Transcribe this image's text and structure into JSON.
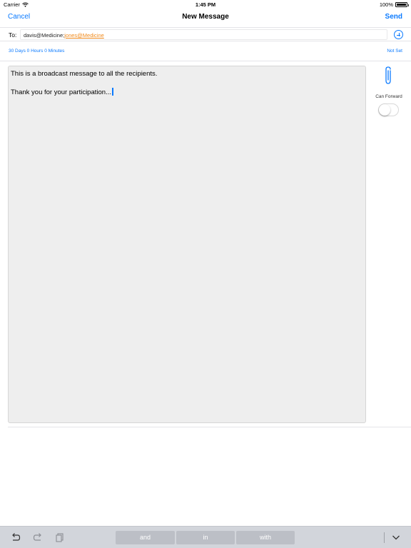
{
  "status_bar": {
    "carrier": "Carrier",
    "time": "1:45 PM",
    "battery": "100%",
    "battery_level": 1.0
  },
  "nav": {
    "cancel": "Cancel",
    "title": "New Message",
    "send": "Send"
  },
  "recipients": {
    "label": "To:",
    "items": [
      "davis@Medicine;",
      "jones@Medicine"
    ]
  },
  "expiry": {
    "duration": "30 Days 0 Hours 0 Minutes",
    "status": "Not Set"
  },
  "message": {
    "lines": [
      "This is a broadcast message to all the recipients.",
      "Thank you for your participation..."
    ]
  },
  "side": {
    "can_forward_label": "Can Forward",
    "can_forward_on": false
  },
  "keyboard": {
    "suggestions": [
      "and",
      "in",
      "with"
    ]
  },
  "colors": {
    "accent": "#0a7aff",
    "link_recipient": "#f08a1c"
  }
}
